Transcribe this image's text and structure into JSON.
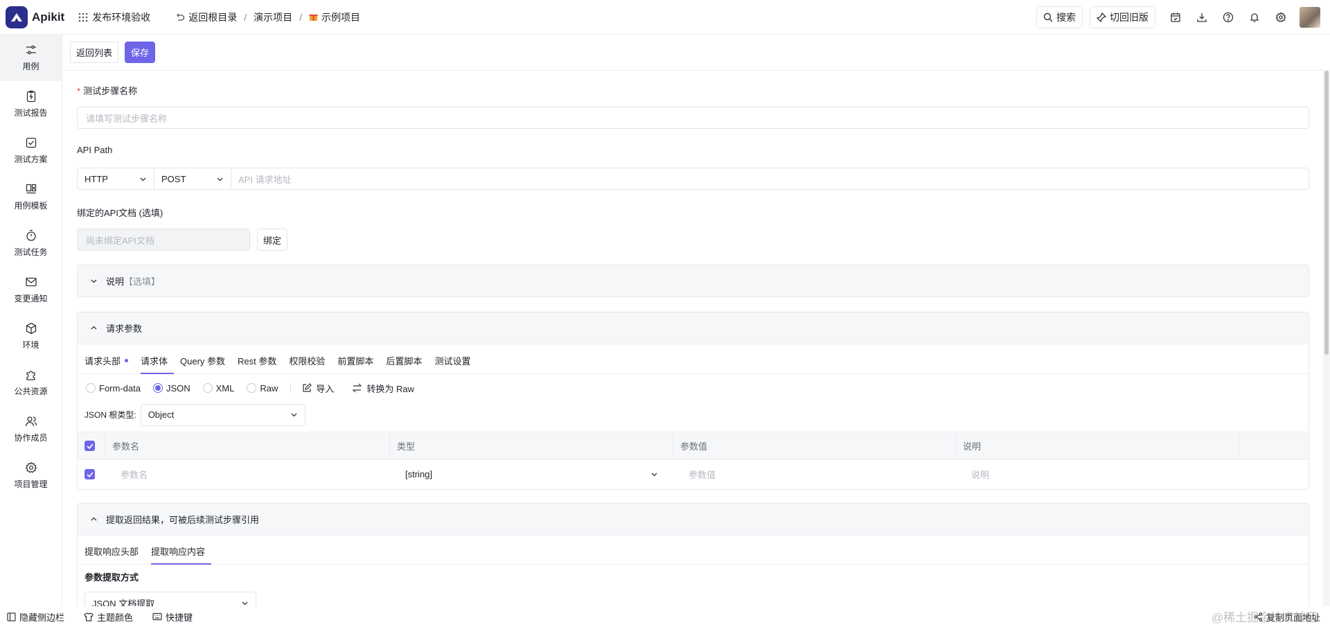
{
  "app": {
    "name": "Apikit"
  },
  "header": {
    "env_label": "发布环境验收",
    "back_root": "返回根目录",
    "crumbs": [
      "演示项目",
      "示例项目"
    ],
    "search_label": "搜索",
    "old_version_label": "切回旧版"
  },
  "sidebar": {
    "items": [
      {
        "label": "用例",
        "icon": "sliders-icon"
      },
      {
        "label": "测试报告",
        "icon": "report-icon"
      },
      {
        "label": "测试方案",
        "icon": "check-square-icon"
      },
      {
        "label": "用例模板",
        "icon": "template-icon"
      },
      {
        "label": "测试任务",
        "icon": "timer-icon"
      },
      {
        "label": "变更通知",
        "icon": "mail-icon"
      },
      {
        "label": "环境",
        "icon": "cube-icon"
      },
      {
        "label": "公共资源",
        "icon": "puzzle-icon"
      },
      {
        "label": "协作成员",
        "icon": "users-icon"
      },
      {
        "label": "项目管理",
        "icon": "gear-icon"
      }
    ]
  },
  "toolbar": {
    "back_list": "返回列表",
    "save": "保存"
  },
  "form": {
    "step_name_label": "测试步骤名称",
    "step_name_placeholder": "请填写测试步骤名称",
    "api_path_label": "API Path",
    "protocol": "HTTP",
    "method": "POST",
    "api_placeholder": "API 请求地址",
    "bind_doc_label": "绑定的API文档 (选填)",
    "bind_doc_placeholder": "尚未绑定API文档",
    "bind_button": "绑定"
  },
  "desc_panel": {
    "title": "说明",
    "hint": "【选填】"
  },
  "request_panel": {
    "title": "请求参数",
    "tabs": [
      "请求头部",
      "请求体",
      "Query 参数",
      "Rest 参数",
      "权限校验",
      "前置脚本",
      "后置脚本",
      "测试设置"
    ],
    "active_tab": "请求体",
    "body_types": [
      "Form-data",
      "JSON",
      "XML",
      "Raw"
    ],
    "selected_body_type": "JSON",
    "import_label": "导入",
    "convert_label": "转换为 Raw",
    "root_type_label": "JSON 根类型:",
    "root_type_value": "Object",
    "table": {
      "headers": [
        "参数名",
        "类型",
        "参数值",
        "说明"
      ],
      "row": {
        "name_placeholder": "参数名",
        "type": "[string]",
        "value_placeholder": "参数值",
        "desc_placeholder": "说明"
      }
    }
  },
  "extract_panel": {
    "title": "提取返回结果，可被后续测试步骤引用",
    "tabs": [
      "提取响应头部",
      "提取响应内容"
    ],
    "active_tab": "提取响应内容",
    "method_label": "参数提取方式",
    "method_value": "JSON 文档提取"
  },
  "footer": {
    "hide_sidebar": "隐藏侧边栏",
    "theme": "主题颜色",
    "shortcuts": "快捷键",
    "copy_url": "复制页面地址",
    "watermark": "@稀土掘金技术社区"
  }
}
